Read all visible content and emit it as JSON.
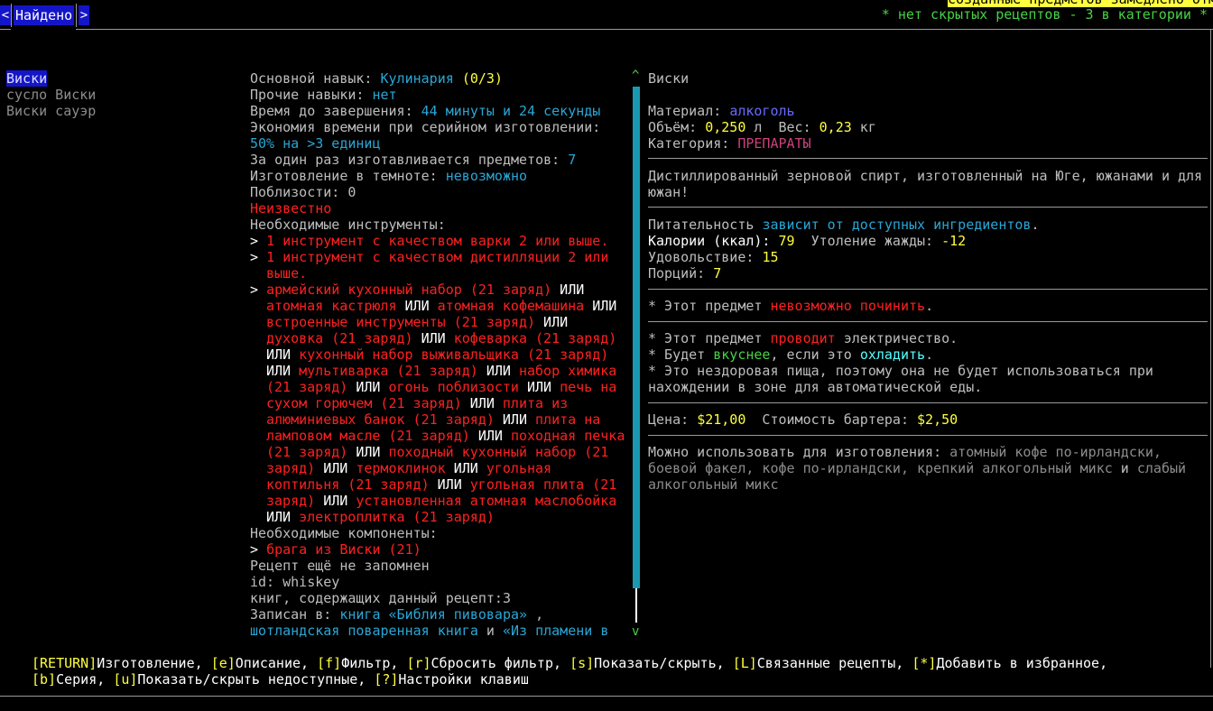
{
  "header": {
    "prev_tab_label": "<",
    "next_tab_label": ">",
    "active_tab": "Найдено",
    "batch_notice": "созданные предметов замедлено отм",
    "hidden_recipes": "* нет скрытых рецептов - 3 в категории *"
  },
  "results": [
    {
      "label": "Виски",
      "selected": true
    },
    {
      "label": "сусло Виски",
      "selected": false
    },
    {
      "label": "Виски сауэр",
      "selected": false
    }
  ],
  "recipe": {
    "primary_skill_label": "Основной навык: ",
    "primary_skill": "Кулинария",
    "primary_skill_level": "(0/3)",
    "other_skills_label": "Прочие навыки: ",
    "other_skills": "нет",
    "time_label": "Время до завершения: ",
    "time": "44 минуты и 24 секунды",
    "batch_saving_label": "Экономия времени при серийном изготовлении:",
    "batch_saving": "50% на >3 единиц",
    "per_batch_label": "За один раз изготавливается предметов: ",
    "per_batch": "7",
    "dark_label": "Изготовление в темноте: ",
    "dark": "невозможно",
    "nearby_label": "Поблизости: ",
    "nearby": "0",
    "unknown": "Неизвестно",
    "tools_header": "Необходимые инструменты:",
    "tool_1": "1 инструмент с качеством варки 2 или выше.",
    "tool_2a": "1 инструмент с качеством дистилляции 2 или",
    "tool_2b": "выше.",
    "or": "ИЛИ",
    "tool_alternatives": [
      "армейский кухонный набор (21 заряд)",
      "атомная кастрюля",
      "атомная кофемашина",
      "встроенные инструменты (21 заряд)",
      "духовка (21 заряд)",
      "кофеварка (21 заряд)",
      "кухонный набор выживальщика (21 заряд)",
      "мультиварка (21 заряд)",
      "набор химика (21 заряд)",
      "огонь поблизости",
      "печь на сухом горючем (21 заряд)",
      "плита из алюминиевых банок (21 заряд)",
      "плита на ламповом масле (21 заряд)",
      "походная печка (21 заряд)",
      "походный кухонный набор (21 заряд)",
      "термоклинок",
      "угольная коптильня (21 заряд)",
      "угольная плита (21 заряд)",
      "установленная атомная маслобойка",
      "электроплитка (21 заряд)"
    ],
    "components_header": "Необходимые компоненты:",
    "component_1": "брага из Виски (21)",
    "not_memorized": "Рецепт ещё не запомнен",
    "id_line": "id: whiskey",
    "books_count": "книг, содержащих данный рецепт:3",
    "written_in_label": "Записан в: ",
    "book_1": "книга «Библия пивовара»",
    "book_1_suffix": " ,",
    "book_2": "шотландская поваренная книга",
    "book_sep": " и ",
    "book_3": "«Из пламени в"
  },
  "item": {
    "name": "Виски",
    "material_label": "Материал: ",
    "material": "алкоголь",
    "volume_label": "Объём: ",
    "volume": "0,250",
    "volume_unit": " л  ",
    "weight_label": "Вес: ",
    "weight": "0,23",
    "weight_unit": " кг",
    "category_label": "Категория: ",
    "category": "ПРЕПАРАТЫ",
    "description_1": "Дистиллированный зерновой спирт, изготовленный на Юге, южанами и для",
    "description_2": "южан!",
    "nutrition_label": "Питательность ",
    "nutrition": "зависит от доступных ингредиентов",
    "nutrition_end": ".",
    "calories_label": "Калории (ккал): ",
    "calories": "79",
    "thirst_label": "  Утоление жажды: ",
    "thirst": "-12",
    "fun_label": "Удовольствие: ",
    "fun": "15",
    "portions_label": "Порций: ",
    "portions": "7",
    "repair_pre": "* Этот предмет ",
    "repair": "невозможно починить",
    "repair_end": ".",
    "conduct_pre": "* Этот предмет ",
    "conduct": "проводит",
    "conduct_post": " электричество.",
    "tasty_pre": "* Будет ",
    "tasty": "вкуснее",
    "tasty_mid": ", если это ",
    "tasty_action": "охладить",
    "tasty_end": ".",
    "unhealthy_1": "* Это нездоровая пища, поэтому она не будет использоваться при",
    "unhealthy_2": "нахождении в зоне для автоматической еды.",
    "price_label": "Цена: ",
    "price": "$21,00",
    "barter_label": "  Стоимость бартера: ",
    "barter": "$2,50",
    "used_in_label": "Можно использовать для изготовления: ",
    "used_in_1": "атомный кофе по-ирландски,",
    "used_in_2": "боевой факел, кофе по-ирландски, крепкий алкогольный микс",
    "used_in_and": " и ",
    "used_in_3": "слабый",
    "used_in_4": "алкогольный микс"
  },
  "footer": {
    "k_return": "[RETURN]",
    "a_return": "Изготовление, ",
    "k_e": "[e]",
    "a_e": "Описание, ",
    "k_f": "[f]",
    "a_f": "Фильтр, ",
    "k_r": "[r]",
    "a_r": "Сбросить фильтр, ",
    "k_s": "[s]",
    "a_s": "Показать/скрыть, ",
    "k_L": "[L]",
    "a_L": "Связанные рецепты, ",
    "k_star": "[*]",
    "a_star": "Добавить в избранное,",
    "k_b": "[b]",
    "a_b": "Серия, ",
    "k_u": "[u]",
    "a_u": "Показать/скрыть недоступные, ",
    "k_q": "[?]",
    "a_q": "Настройки клавиш"
  },
  "colors": {
    "background": "#000000",
    "highlight": "#1515c8",
    "scrollbar": "#1a9ab0",
    "warning": "#ff2020",
    "info": "#2aa6d6",
    "value": "#ffff40"
  }
}
